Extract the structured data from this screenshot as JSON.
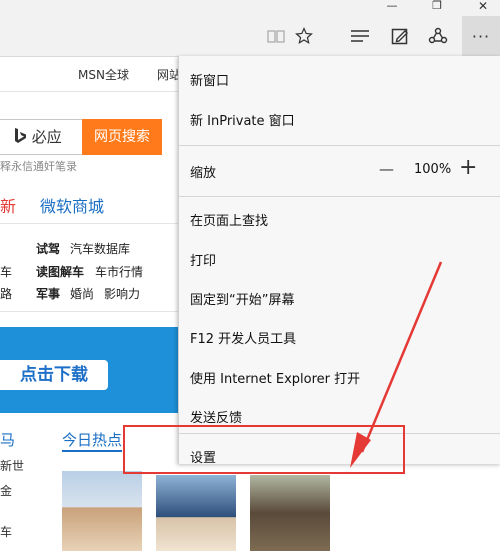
{
  "window": {
    "minimize_glyph": "—",
    "restore_glyph": "❐",
    "close_glyph": "✕"
  },
  "toolbar": {
    "icons": [
      "reading-view-icon",
      "favorite-star-icon",
      "hub-icon",
      "web-note-icon",
      "share-icon",
      "more-icon"
    ],
    "more_label": "···"
  },
  "page": {
    "nav_msn": "MSN全球",
    "nav_web": "网站",
    "search_engine_label": "必应",
    "search_button": "网页搜索",
    "hint": "释永信通奸笔录",
    "link_new": "新",
    "link_store": "微软商城",
    "grid": [
      [
        "试驾",
        "汽车数据库"
      ],
      [
        "读图解车",
        "车市行情"
      ],
      [
        "军事",
        "婚尚",
        "影响力"
      ]
    ],
    "left_chars": [
      "",
      "车",
      "路"
    ],
    "download": "点击下载",
    "hot_title": "今日热点",
    "horse": "马",
    "side_texts": [
      "新世",
      "金",
      "车"
    ]
  },
  "menu": {
    "items": [
      {
        "label": "新窗口"
      },
      {
        "label": "新 InPrivate 窗口"
      },
      {
        "label": "缩放"
      },
      {
        "label": "在页面上查找"
      },
      {
        "label": "打印"
      },
      {
        "label": "固定到“开始”屏幕"
      },
      {
        "label": "F12 开发人员工具"
      },
      {
        "label": "使用 Internet Explorer 打开"
      },
      {
        "label": "发送反馈"
      },
      {
        "label": "设置"
      }
    ],
    "zoom_minus": "—",
    "zoom_value": "100%",
    "zoom_plus": "+"
  },
  "colors": {
    "annotation": "#e53935",
    "banner": "#1e8fd9",
    "search_button": "#ff7a1a"
  }
}
